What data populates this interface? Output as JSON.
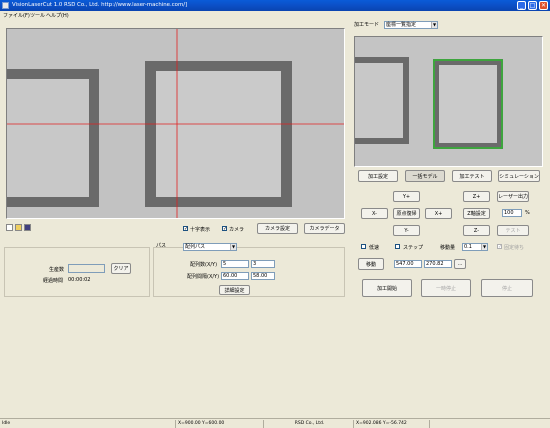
{
  "window": {
    "title": "VisionLaserCut 1.0  RSD Co., Ltd. http://www.laser-machine.com/]",
    "min": "_",
    "max": "□",
    "close": "✕"
  },
  "menu": [
    "ファイル(F)",
    "ツール",
    "ヘルプ(H)"
  ],
  "toolbar_icons": [
    "new-file-icon",
    "open-folder-icon",
    "save-icon"
  ],
  "camera": {
    "crosshair_label": "十字表示",
    "crosshair_checked": "✓",
    "camera_label": "カメラ",
    "camera_checked": "✓",
    "camera_settings": "カメラ設定",
    "camera_data": "カメラデータ"
  },
  "mode": {
    "label": "加工モード",
    "value": "座標一覧指定"
  },
  "tabs": {
    "settings": "加工設定",
    "one_model": "一括モデル",
    "test": "加工テスト",
    "simulation": "シミュレーション"
  },
  "jog": {
    "y_plus": "Y+",
    "y_minus": "Y-",
    "x_minus": "X-",
    "x_plus": "X+",
    "origin": "原点復帰",
    "z_plus": "Z+",
    "z_minus": "Z-",
    "laser_output": "レーザー出力",
    "z_axis_settings": "Z軸設定",
    "power_value": "100",
    "power_unit": "%",
    "test": "テスト"
  },
  "options": {
    "step_label": "低速",
    "step_checked": "",
    "snap_label": "ステップ",
    "snap_checked": "",
    "move_amount_label": "移動量",
    "move_amount_value": "0.1",
    "fixed_label": "固定待ち",
    "fixed_checked": "✓"
  },
  "move": {
    "button": "移動",
    "x_value": "547.00",
    "y_value": "270.82",
    "browse": "..."
  },
  "process": {
    "start": "加工開始",
    "pause": "一時停止",
    "stop": "停止"
  },
  "production": {
    "count_label": "生産数",
    "count_value": "",
    "clear": "クリア",
    "elapsed_label": "経過時間",
    "elapsed_value": "00:00:02"
  },
  "path": {
    "label": "パス",
    "value": "配列パス",
    "array_count_label": "配列数(X/Y)",
    "array_count_x": "5",
    "array_count_y": "3",
    "array_spacing_label": "配列間隔(X/Y)",
    "array_spacing_x": "60.00",
    "array_spacing_y": "58.00",
    "detail_settings": "詳細設定"
  },
  "status": {
    "state": "Idle",
    "coords": "X=900.00 Y=600.00",
    "company": "RSD Co., Ltd.",
    "mouse": "X=902.086 Y=-56.742"
  }
}
